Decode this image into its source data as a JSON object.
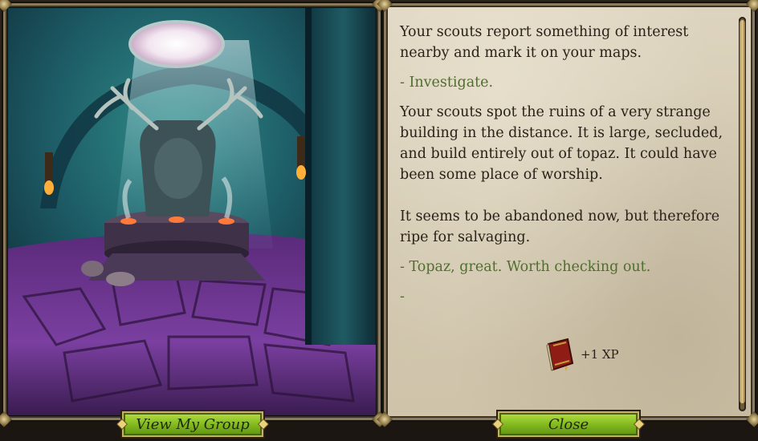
{
  "story": {
    "paragraphs": [
      "Your scouts report something of interest nearby and mark it on your maps."
    ],
    "choice1": "- Investigate.",
    "paragraph2": "Your scouts spot the ruins of a very strange building in the distance. It is large, secluded, and build entirely out of topaz. It could have been some place of worship.\n\nIt seems to be abandoned now, but therefore ripe for salvaging.",
    "choice2": "- Topaz, great. Worth checking out.",
    "choice3": "-"
  },
  "reward": {
    "label": "+1 XP",
    "icon": "book-icon"
  },
  "buttons": {
    "view_group": "View My Group",
    "close": "Close"
  },
  "colors": {
    "choice": "#4f6e2e",
    "text": "#2a2118",
    "button": "#88bf22",
    "parchment": "#d3c9b2"
  }
}
